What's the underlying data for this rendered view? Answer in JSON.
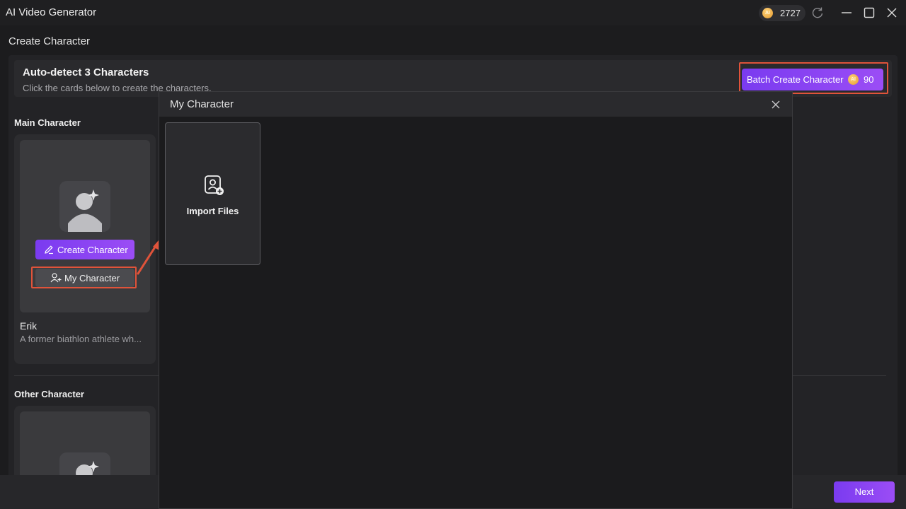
{
  "window": {
    "title": "AI Video Generator",
    "credits": "2727",
    "coin_symbol": "AI"
  },
  "page": {
    "title": "Create Character"
  },
  "auto_detect": {
    "title": "Auto-detect 3 Characters",
    "subtitle": "Click the cards below to create the characters.",
    "batch_button_label": "Batch Create Character",
    "batch_cost": "90"
  },
  "main_section": {
    "label": "Main Character",
    "card": {
      "create_label": "Create Character",
      "my_character_label": "My Character",
      "name": "Erik",
      "description": "A former biathlon athlete wh..."
    }
  },
  "other_section": {
    "label": "Other Character"
  },
  "footer": {
    "next_label": "Next"
  },
  "modal": {
    "title": "My Character",
    "import_label": "Import Files"
  },
  "colors": {
    "accent_purple": "#8b45f4",
    "highlight_red": "#e0533a",
    "coin_gold": "#f0b04a"
  }
}
